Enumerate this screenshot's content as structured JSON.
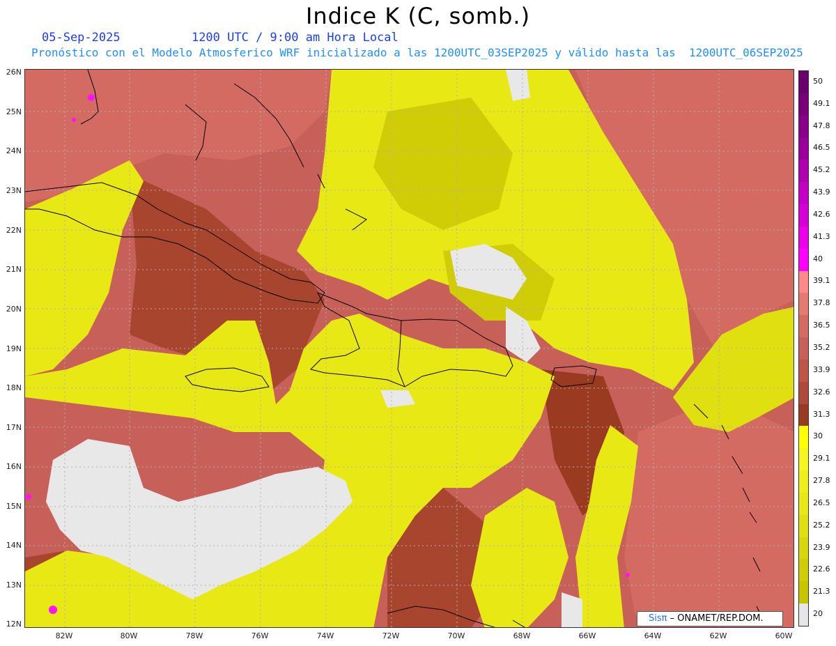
{
  "header": {
    "title": "Indice K (C, somb.)",
    "date": "05-Sep-2025",
    "time": "1200 UTC / 9:00 am Hora Local",
    "subtitle": "Pronóstico con el Modelo Atmosferico WRF inicializado a las 1200UTC_03SEP2025 y válido hasta las  1200UTC_06SEP2025"
  },
  "map": {
    "lat_labels": [
      "26N",
      "25N",
      "24N",
      "23N",
      "22N",
      "21N",
      "20N",
      "19N",
      "18N",
      "17N",
      "16N",
      "15N",
      "14N",
      "13N",
      "12N"
    ],
    "lon_labels": [
      "82W",
      "80W",
      "78W",
      "76W",
      "74W",
      "72W",
      "70W",
      "68W",
      "66W",
      "64W",
      "62W",
      "60W"
    ],
    "colors": {
      "below20": "#e8e8e8",
      "yellow_low": "#c8c400",
      "yellow_mid": "#e4e410",
      "yellow_high": "#f5f520",
      "red_dark": "#9a3a20",
      "red_mid": "#b85545",
      "red_light": "#d46b62",
      "magenta": "#ff10ff",
      "coast": "#000000"
    }
  },
  "colorbar": {
    "labels": [
      "50",
      "49.1",
      "47.8",
      "46.5",
      "45.2",
      "43.9",
      "42.6",
      "41.3",
      "40",
      "39.1",
      "37.8",
      "36.5",
      "35.2",
      "33.9",
      "32.6",
      "31.3",
      "30",
      "29.1",
      "27.8",
      "26.5",
      "25.2",
      "23.9",
      "22.6",
      "21.3",
      "20"
    ],
    "colors": [
      "#6a006a",
      "#7a007a",
      "#8a008a",
      "#9c009c",
      "#b000b0",
      "#c400c4",
      "#d800d8",
      "#ec00ec",
      "#ff00ff",
      "#ff8888",
      "#e57a6e",
      "#d46b62",
      "#c8605a",
      "#bd5648",
      "#b04a38",
      "#9a3a20",
      "#ffff00",
      "#f5f520",
      "#eeee18",
      "#e8e814",
      "#e0e010",
      "#d8d60c",
      "#d0cc06",
      "#c8c400",
      "#e6e6e6"
    ]
  },
  "credit": {
    "brand": "Sisπ",
    "text": " – ONAMET/REP.DOM."
  }
}
